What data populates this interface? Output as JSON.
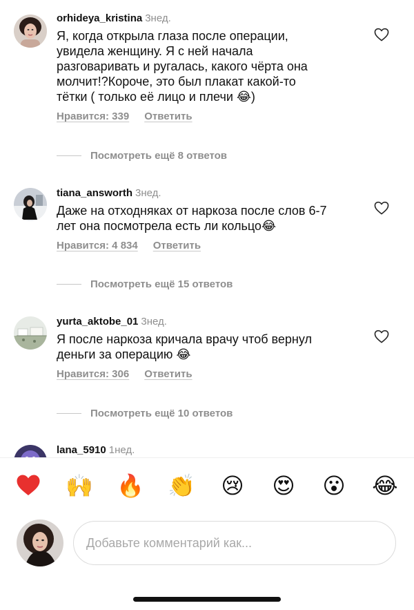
{
  "comments": [
    {
      "username": "orhideya_kristina",
      "time": "3нед.",
      "lines": [
        "Я, когда открыла глаза после операции,",
        "увидела женщину. Я с ней начала",
        "разговаривать и ругалась, какого чёрта она",
        "молчит!?Короче, это был плакат какой-то",
        "тётки ( только её лицо и плечи 😂)"
      ],
      "likes": "Нравится: 339",
      "reply": "Ответить",
      "view_replies": "Посмотреть ещё 8 ответов"
    },
    {
      "username": "tiana_answorth",
      "time": "3нед.",
      "lines": [
        "Даже на отходняках от наркоза после слов 6-7",
        "лет она посмотрела есть ли кольцо😂"
      ],
      "likes": "Нравится: 4 834",
      "reply": "Ответить",
      "view_replies": "Посмотреть ещё 15 ответов"
    },
    {
      "username": "yurta_aktobe_01",
      "time": "3нед.",
      "lines": [
        "Я после наркоза кричала врачу чтоб вернул",
        "деньги за операцию 😂"
      ],
      "likes": "Нравится: 306",
      "reply": "Ответить",
      "view_replies": "Посмотреть ещё 10 ответов"
    },
    {
      "username": "lana_5910",
      "time": "1нед."
    }
  ],
  "emoji_bar": [
    {
      "icon": "red-heart-icon",
      "glyph": "❤️"
    },
    {
      "icon": "raising-hands-icon",
      "glyph": "🙌"
    },
    {
      "icon": "fire-icon",
      "glyph": "🔥"
    },
    {
      "icon": "clapping-hands-icon",
      "glyph": "👏"
    },
    {
      "icon": "crying-face-icon",
      "glyph": "😢"
    },
    {
      "icon": "heart-eyes-icon",
      "glyph": "😍"
    },
    {
      "icon": "surprised-face-icon",
      "glyph": "😮"
    },
    {
      "icon": "tears-of-joy-icon",
      "glyph": "😂"
    }
  ],
  "composer": {
    "placeholder": "Добавьте комментарий как..."
  },
  "colors": {
    "secondary_text": "#8e8e8e",
    "divider": "#efefef",
    "input_border": "#dbdbdb",
    "heart_red": "#e8302e"
  }
}
